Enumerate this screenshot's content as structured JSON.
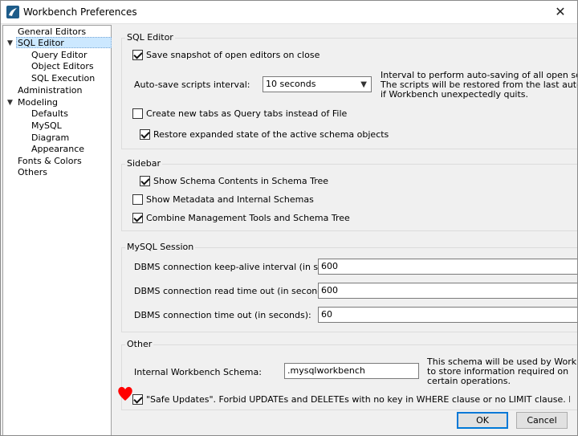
{
  "window": {
    "title": "Workbench Preferences"
  },
  "tree": {
    "items": [
      {
        "label": "General Editors",
        "level": 0
      },
      {
        "label": "SQL Editor",
        "level": 0,
        "expanded": true,
        "selected": true
      },
      {
        "label": "Query Editor",
        "level": 1
      },
      {
        "label": "Object Editors",
        "level": 1
      },
      {
        "label": "SQL Execution",
        "level": 1
      },
      {
        "label": "Administration",
        "level": 0
      },
      {
        "label": "Modeling",
        "level": 0,
        "expanded": true
      },
      {
        "label": "Defaults",
        "level": 1
      },
      {
        "label": "MySQL",
        "level": 1
      },
      {
        "label": "Diagram",
        "level": 1
      },
      {
        "label": "Appearance",
        "level": 1
      },
      {
        "label": "Fonts & Colors",
        "level": 0
      },
      {
        "label": "Others",
        "level": 0
      }
    ]
  },
  "sql_editor": {
    "title": "SQL Editor",
    "save_snapshot": {
      "label": "Save snapshot of open editors on close",
      "checked": true
    },
    "autosave": {
      "label": "Auto-save scripts interval:",
      "value": "10 seconds",
      "hint_lines": [
        "Interval to perform auto-saving of all open script tabs",
        "The scripts will be restored from the last auto-saved v",
        "if Workbench unexpectedly quits."
      ]
    },
    "new_tabs_query": {
      "label": "Create new tabs as Query tabs instead of File",
      "checked": false
    },
    "restore_expanded": {
      "label": "Restore expanded state of the active schema objects",
      "checked": true
    }
  },
  "sidebar": {
    "title": "Sidebar",
    "show_schema_contents": {
      "label": "Show Schema Contents in Schema Tree",
      "checked": true
    },
    "show_metadata": {
      "label": "Show Metadata and Internal Schemas",
      "checked": false
    },
    "combine_tools": {
      "label": "Combine Management Tools and Schema Tree",
      "checked": true
    }
  },
  "mysql_session": {
    "title": "MySQL Session",
    "keepalive": {
      "label": "DBMS connection keep-alive interval (in seconds):",
      "value": "600"
    },
    "read_timeout": {
      "label": "DBMS connection read time out (in seconds):",
      "value": "600"
    },
    "conn_timeout": {
      "label": "DBMS connection time out (in seconds):",
      "value": "60"
    }
  },
  "other": {
    "title": "Other",
    "internal_schema": {
      "label": "Internal Workbench Schema:",
      "value": ".mysqlworkbench",
      "hint_lines": [
        "This schema will be used by Workbench.",
        "to store information required on",
        "certain operations."
      ]
    },
    "safe_updates": {
      "label": "\"Safe Updates\". Forbid UPDATEs and DELETEs with no key in WHERE clause or no LIMIT clause. Requires a reconnection.",
      "checked": true
    }
  },
  "buttons": {
    "ok": "OK",
    "cancel": "Cancel"
  },
  "colors": {
    "selection": "#cce8ff",
    "annotation": "#ff0000",
    "ok_border": "#0078d7"
  }
}
